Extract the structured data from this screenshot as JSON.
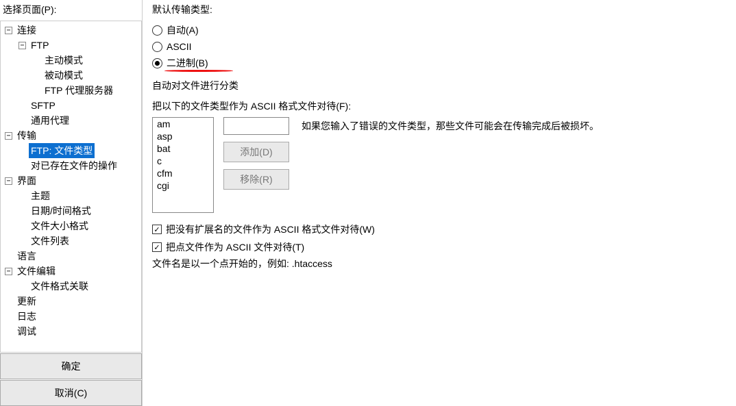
{
  "sidebar": {
    "title": "选择页面(P):",
    "ok": "确定",
    "cancel": "取消(C)",
    "tree": [
      {
        "depth": 0,
        "toggle": "-",
        "label": "连接",
        "sel": false
      },
      {
        "depth": 1,
        "toggle": "-",
        "label": "FTP",
        "sel": false
      },
      {
        "depth": 2,
        "toggle": "",
        "label": "主动模式",
        "sel": false
      },
      {
        "depth": 2,
        "toggle": "",
        "label": "被动模式",
        "sel": false
      },
      {
        "depth": 2,
        "toggle": "",
        "label": "FTP 代理服务器",
        "sel": false
      },
      {
        "depth": 1,
        "toggle": "",
        "label": "SFTP",
        "sel": false
      },
      {
        "depth": 1,
        "toggle": "",
        "label": "通用代理",
        "sel": false
      },
      {
        "depth": 0,
        "toggle": "-",
        "label": "传输",
        "sel": false
      },
      {
        "depth": 1,
        "toggle": "",
        "label": "FTP: 文件类型",
        "sel": true
      },
      {
        "depth": 1,
        "toggle": "",
        "label": "对已存在文件的操作",
        "sel": false
      },
      {
        "depth": 0,
        "toggle": "-",
        "label": "界面",
        "sel": false
      },
      {
        "depth": 1,
        "toggle": "",
        "label": "主题",
        "sel": false
      },
      {
        "depth": 1,
        "toggle": "",
        "label": "日期/时间格式",
        "sel": false
      },
      {
        "depth": 1,
        "toggle": "",
        "label": "文件大小格式",
        "sel": false
      },
      {
        "depth": 1,
        "toggle": "",
        "label": "文件列表",
        "sel": false
      },
      {
        "depth": 0,
        "toggle": "",
        "label": "语言",
        "sel": false
      },
      {
        "depth": 0,
        "toggle": "-",
        "label": "文件编辑",
        "sel": false
      },
      {
        "depth": 1,
        "toggle": "",
        "label": "文件格式关联",
        "sel": false
      },
      {
        "depth": 0,
        "toggle": "",
        "label": "更新",
        "sel": false
      },
      {
        "depth": 0,
        "toggle": "",
        "label": "日志",
        "sel": false
      },
      {
        "depth": 0,
        "toggle": "",
        "label": "调试",
        "sel": false
      }
    ]
  },
  "main": {
    "defaultTransferTitle": "默认传输类型:",
    "radios": {
      "auto": "自动(A)",
      "ascii": "ASCII",
      "binary": "二进制(B)"
    },
    "selectedRadio": "binary",
    "autoClassifyTitle": "自动对文件进行分类",
    "asciiLabel": "把以下的文件类型作为 ASCII 格式文件对待(F):",
    "extensions": [
      "am",
      "asp",
      "bat",
      "c",
      "cfm",
      "cgi"
    ],
    "newExtValue": "",
    "hint": "如果您输入了错误的文件类型，那些文件可能会在传输完成后被损坏。",
    "addBtn": "添加(D)",
    "removeBtn": "移除(R)",
    "checkNoExt": "把没有扩展名的文件作为 ASCII 格式文件对待(W)",
    "checkDotFiles": "把点文件作为 ASCII 文件对待(T)",
    "dotNote": "文件名是以一个点开始的，例如: .htaccess"
  }
}
